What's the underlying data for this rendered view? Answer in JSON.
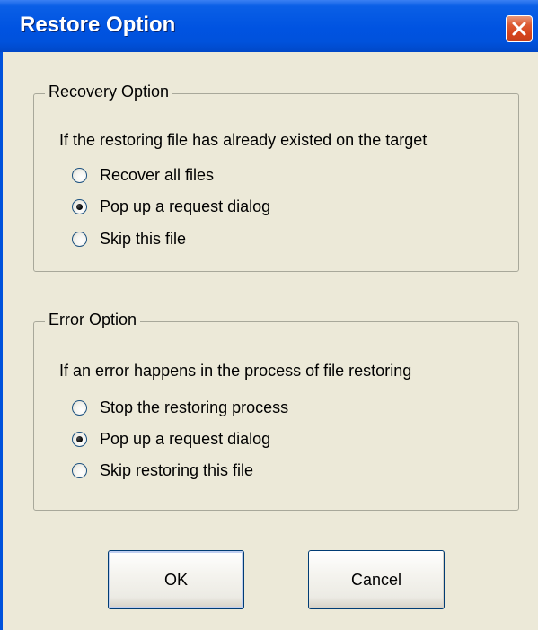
{
  "window": {
    "title": "Restore Option",
    "colors": {
      "titlebar": "#0053E1",
      "face": "#ECE9D8",
      "close": "#D5441C"
    }
  },
  "recovery_group": {
    "legend": "Recovery Option",
    "description": "If the restoring file has already existed on the target",
    "options": [
      {
        "label": "Recover all files",
        "checked": false
      },
      {
        "label": "Pop up a request dialog",
        "checked": true
      },
      {
        "label": "Skip this file",
        "checked": false
      }
    ]
  },
  "error_group": {
    "legend": "Error Option",
    "description": "If an error happens in the process of file restoring",
    "options": [
      {
        "label": "Stop the restoring process",
        "checked": false
      },
      {
        "label": "Pop up a request dialog",
        "checked": true
      },
      {
        "label": "Skip restoring this file",
        "checked": false
      }
    ]
  },
  "buttons": {
    "ok_label": "OK",
    "cancel_label": "Cancel"
  },
  "icons": {
    "close": "close-icon",
    "radio": "radio-button"
  }
}
